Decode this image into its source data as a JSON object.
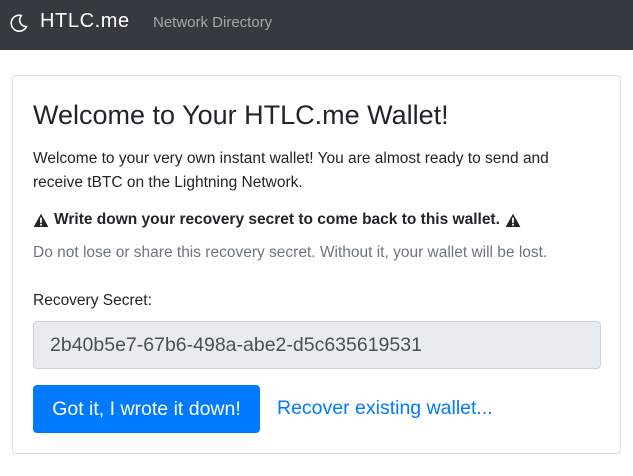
{
  "navbar": {
    "theme_icon": "moon-icon",
    "brand": "HTLC.me",
    "links": [
      {
        "label": "Network Directory"
      }
    ]
  },
  "card": {
    "title": "Welcome to Your HTLC.me Wallet!",
    "intro": "Welcome to your very own instant wallet! You are almost ready to send and receive tBTC on the Lightning Network.",
    "warning": {
      "icon": "warning-triangle-icon",
      "text": "Write down your recovery secret to come back to this wallet."
    },
    "caution": "Do not lose or share this recovery secret. Without it, your wallet will be lost.",
    "recovery_label": "Recovery Secret:",
    "recovery_secret": "2b40b5e7-67b6-498a-abe2-d5c635619531",
    "confirm_button": "Got it, I wrote it down!",
    "recover_link": "Recover existing wallet..."
  },
  "colors": {
    "navbar_bg": "#343a40",
    "primary": "#007bff",
    "muted_text": "#6c757d",
    "input_bg": "#e9ecef"
  }
}
